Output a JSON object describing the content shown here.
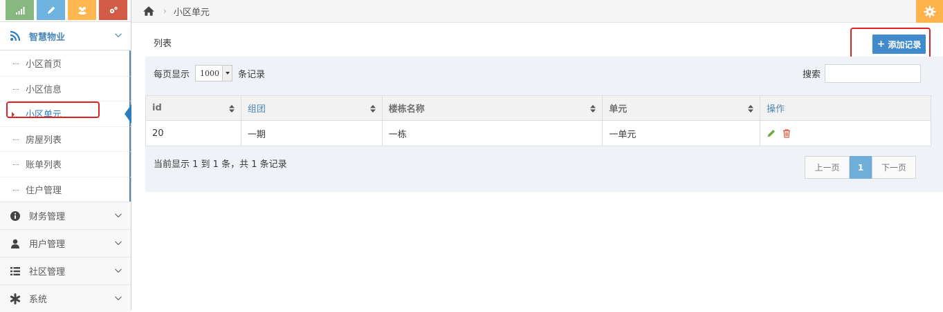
{
  "sidebar": {
    "shortcut_colors": [
      "#87b87f",
      "#6fb3e0",
      "#ffb752",
      "#d15b47"
    ],
    "shortcut_icons": [
      "signal-icon",
      "pencil-icon",
      "users-icon",
      "cogs-icon"
    ],
    "menu_top": {
      "label": "智慧物业",
      "icon": "rss-icon"
    },
    "submenu": [
      {
        "label": "小区首页",
        "active": false
      },
      {
        "label": "小区信息",
        "active": false
      },
      {
        "label": "小区单元",
        "active": true
      },
      {
        "label": "房屋列表",
        "active": false
      },
      {
        "label": "账单列表",
        "active": false
      },
      {
        "label": "住户管理",
        "active": false
      }
    ],
    "groups": [
      {
        "label": "财务管理",
        "icon": "info-circle-icon"
      },
      {
        "label": "用户管理",
        "icon": "user-icon"
      },
      {
        "label": "社区管理",
        "icon": "list-icon"
      },
      {
        "label": "系统",
        "icon": "asterisk-icon"
      }
    ]
  },
  "breadcrumb": {
    "home_icon": "home-icon",
    "current": "小区单元"
  },
  "main": {
    "list_title": "列表",
    "add_button": "添加记录",
    "length_prefix": "每页显示",
    "length_value": "1000",
    "length_suffix": "条记录",
    "search_label": "搜索",
    "search_value": "",
    "table": {
      "headers": [
        "id",
        "组团",
        "楼栋名称",
        "单元",
        "操作"
      ],
      "rows": [
        [
          "20",
          "一期",
          "一栋",
          "一单元",
          ""
        ]
      ]
    },
    "info": "当前显示 1 到 1 条，共 1 条记录",
    "pager": {
      "prev": "上一页",
      "current": "1",
      "next": "下一页"
    }
  },
  "colors": {
    "accent": "#428bca",
    "settings": "#ffb44b",
    "highlight": "#e02020",
    "edit": "#69aa46",
    "delete": "#dd5a43"
  }
}
